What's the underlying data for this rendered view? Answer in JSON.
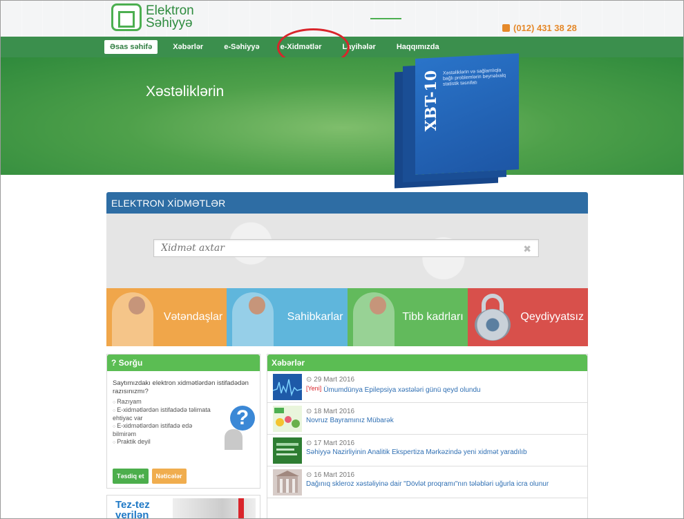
{
  "header": {
    "logo_line1": "Elektron",
    "logo_line2": "Səhiyyə",
    "phone": "(012) 431 38 28"
  },
  "nav": {
    "items": [
      {
        "label": "Əsas səhifə",
        "active": true
      },
      {
        "label": "Xəbərlər",
        "active": false
      },
      {
        "label": "e-Səhiyyə",
        "active": false
      },
      {
        "label": "e-Xidmətlər",
        "active": false
      },
      {
        "label": "Layihələr",
        "active": false
      },
      {
        "label": "Haqqımızda",
        "active": false
      }
    ]
  },
  "hero": {
    "title": "Xəstəliklərin",
    "book_spine": "XBT-10",
    "book_text": "Xəstəliklərin və sağlamlıqla bağlı problemlərin beynəlxalq statistik təsnifatı"
  },
  "services": {
    "heading": "ELEKTRON XİDMƏTLƏR",
    "search_placeholder": "Xidmət axtar",
    "tiles": [
      {
        "label": "Vətəndaşlar",
        "color": "#f0a64a"
      },
      {
        "label": "Sahibkarlar",
        "color": "#5fb6dc"
      },
      {
        "label": "Tibb kadrları",
        "color": "#62ba5c"
      },
      {
        "label": "Qeydiyyatsız",
        "color": "#d8504b"
      }
    ]
  },
  "survey": {
    "heading": "? Sorğu",
    "question": "Saytımızdakı elektron xidmətlərdən istifadədən razısınızmı?",
    "options": [
      "Razıyam",
      "E-xidmətlərdən istifadədə təlimata ehtiyac var",
      "E-xidmətlərdən istifadə edə bilmirəm",
      "Praktik deyil"
    ],
    "submit_label": "Təsdiq et",
    "results_label": "Nəticələr"
  },
  "faq": {
    "title_line1": "Tez-tez",
    "title_line2": "verilən"
  },
  "news": {
    "heading": "Xəbərlər",
    "items": [
      {
        "date": "29 Mart 2016",
        "new_tag": "[Yeni]",
        "title": "Ümumdünya Epilepsiya xəstələri günü qeyd olundu"
      },
      {
        "date": "18 Mart 2016",
        "new_tag": "",
        "title": "Novruz Bayramınız Mübarək"
      },
      {
        "date": "17 Mart 2016",
        "new_tag": "",
        "title": "Səhiyyə Nazirliyinin Analitik Ekspertiza Mərkəzində yeni xidmət yaradılıb"
      },
      {
        "date": "16 Mart 2016",
        "new_tag": "",
        "title": "Dağınıq skleroz xəstəliyinə dair \"Dövlət proqramı\"nın tələbləri uğurla icra olunur"
      }
    ]
  },
  "colors": {
    "primary_green": "#3b8f4d",
    "accent_blue": "#2e6da4",
    "highlight_red": "#d9252b"
  }
}
